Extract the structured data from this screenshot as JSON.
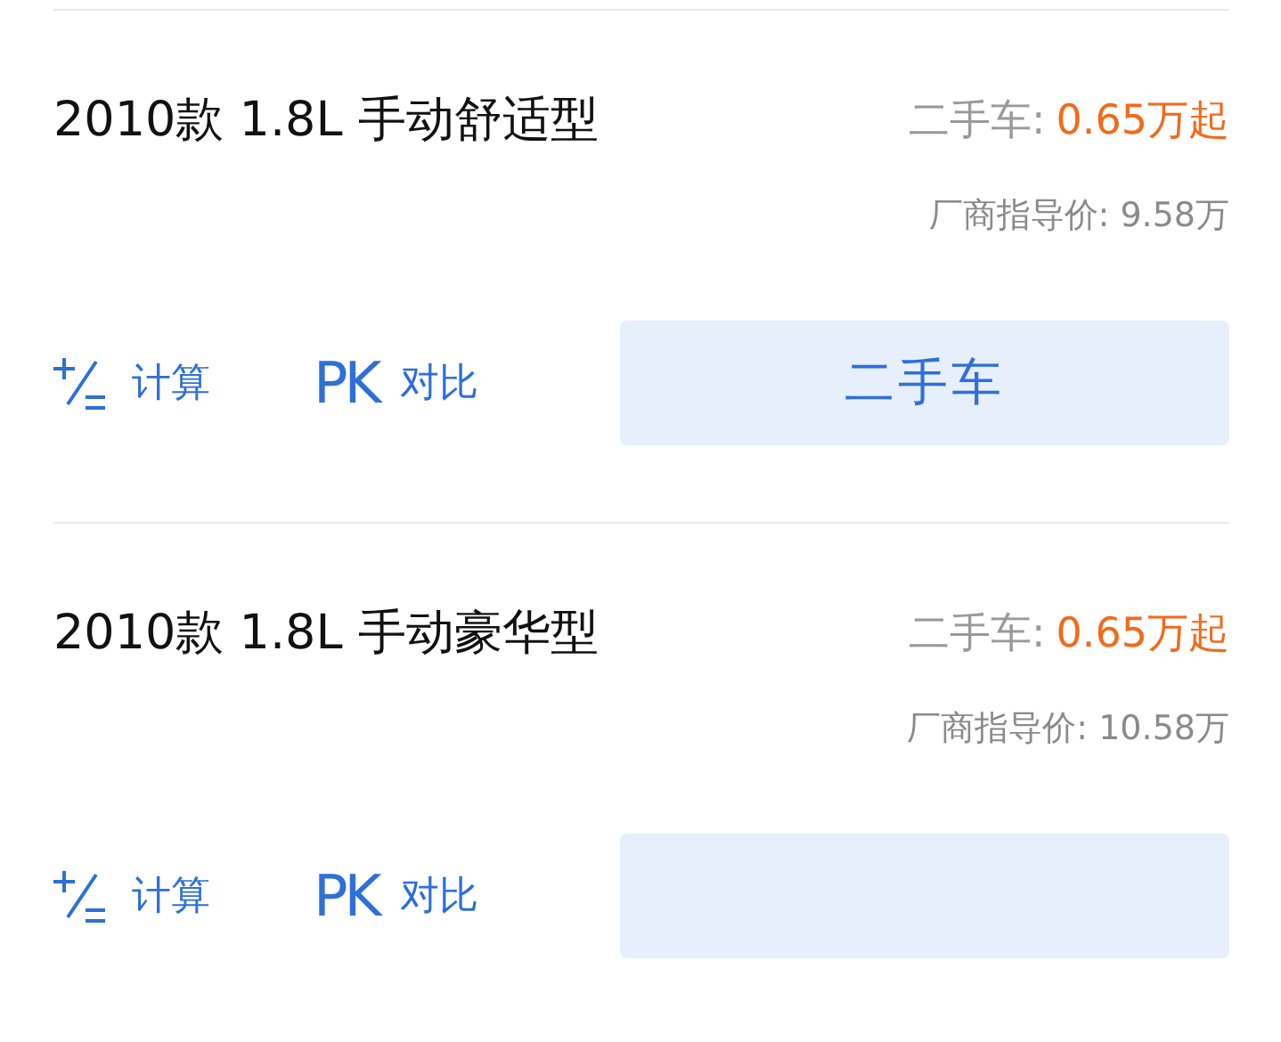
{
  "items": [
    {
      "title": "2010款 1.8L 手动舒适型",
      "price_label": "二手车:",
      "price": "0.65万起",
      "guide": "厂商指导价: 9.58万",
      "actions": [
        {
          "kind": "calc",
          "label": "计算"
        },
        {
          "kind": "pk",
          "prefix": "PK",
          "label": "对比"
        }
      ],
      "has_button": true,
      "button_label": "二手车"
    },
    {
      "title": "2010款 1.8L 手动豪华型",
      "price_label": "二手车:",
      "price": "0.65万起",
      "guide": "厂商指导价: 10.58万",
      "actions": [
        {
          "kind": "calc",
          "label": "计算"
        },
        {
          "kind": "pk",
          "prefix": "PK",
          "label": "对比"
        }
      ],
      "has_button": true
    }
  ]
}
